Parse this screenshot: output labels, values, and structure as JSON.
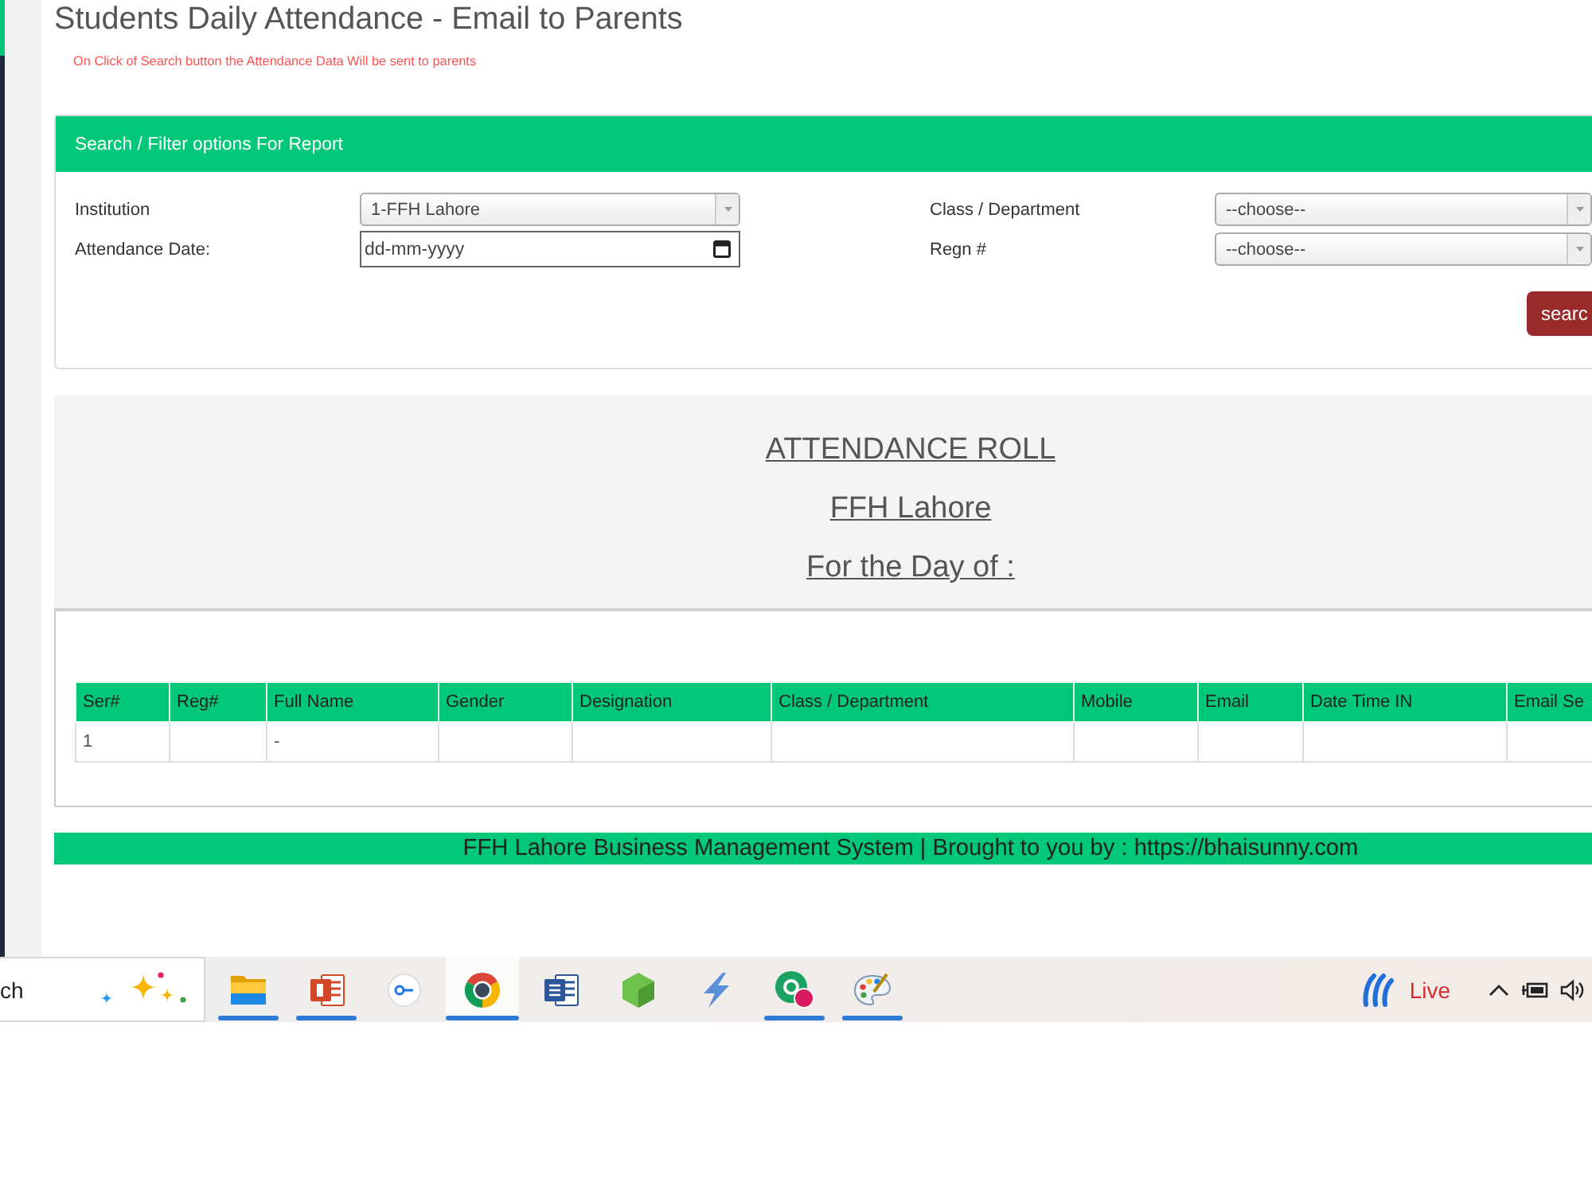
{
  "page": {
    "title": "Students Daily Attendance - Email to Parents",
    "note": "On Click of Search button the Attendance Data Will be sent to parents"
  },
  "filter_panel": {
    "title": "Search / Filter options For Report",
    "fields": [
      {
        "label": "Institution",
        "kind": "select",
        "value": "1-FFH Lahore"
      },
      {
        "label": "Class / Department",
        "kind": "select",
        "value": "--choose--"
      },
      {
        "label": "Attendance Date:",
        "kind": "date",
        "placeholder": "dd-mm-yyyy"
      },
      {
        "label": "Regn #",
        "kind": "select",
        "value": "--choose--"
      }
    ],
    "button": "searc"
  },
  "report": {
    "title": "ATTENDANCE ROLL",
    "institution": "FFH Lahore",
    "date_line": "For the Day of :",
    "table": {
      "columns": [
        "Ser#",
        "Reg#",
        "Full Name",
        "Gender",
        "Designation",
        "Class / Department",
        "Mobile",
        "Email",
        "Date Time IN",
        "Email Se"
      ],
      "rows": [
        [
          "1",
          null,
          "-",
          null,
          null,
          null,
          null,
          null,
          null,
          null
        ]
      ]
    }
  },
  "footer": "FFH Lahore Business Management System | Brought to you by : https://bhaisunny.com",
  "taskbar": {
    "search": {
      "placeholder": "ch"
    },
    "apps": [
      {
        "kind": "folder",
        "running": true,
        "selected": false
      },
      {
        "kind": "presentation",
        "running": true,
        "selected": false
      },
      {
        "kind": "key",
        "running": false,
        "selected": false
      },
      {
        "kind": "browser",
        "running": true,
        "selected": true
      },
      {
        "kind": "document",
        "running": false,
        "selected": false
      },
      {
        "kind": "cube",
        "running": false,
        "selected": false
      },
      {
        "kind": "lightning",
        "running": false,
        "selected": false
      },
      {
        "kind": "circle_badge",
        "running": true,
        "selected": false
      },
      {
        "kind": "palette",
        "running": true,
        "selected": false
      }
    ],
    "widget": {
      "label": "Live"
    }
  }
}
